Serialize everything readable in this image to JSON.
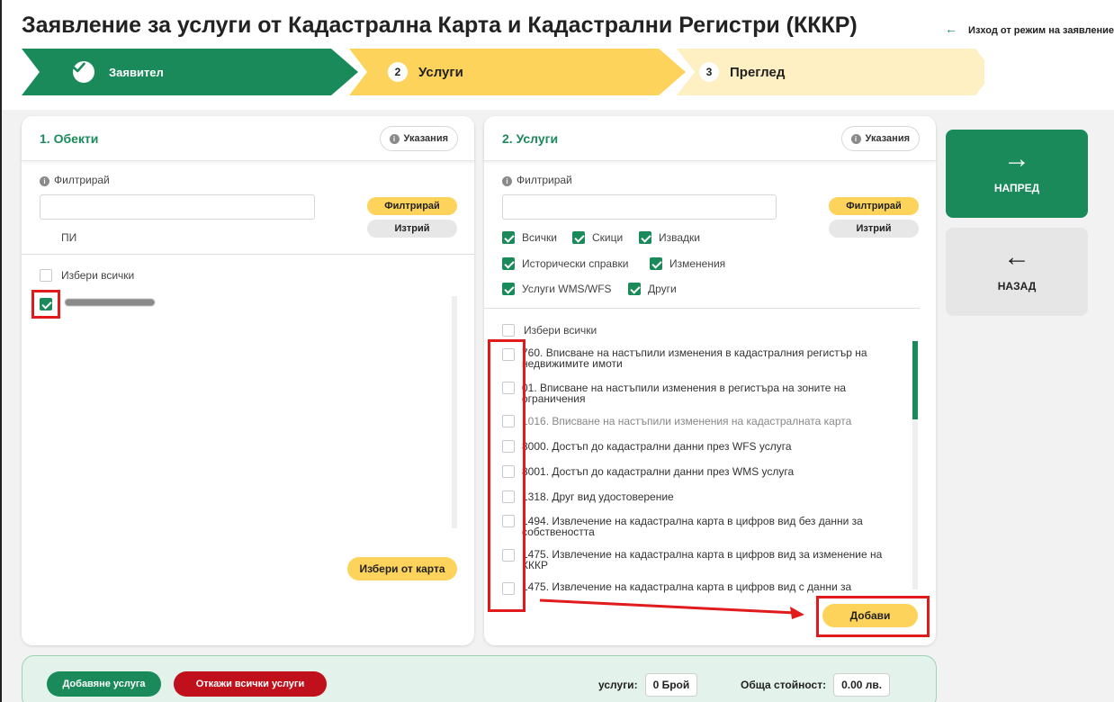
{
  "header": {
    "title": "Заявление за услуги от Кадастрална Карта и Кадастрални Регистри (КККР)",
    "exit_link": "Изход от режим на заявление"
  },
  "steps": [
    {
      "label": "Заявител",
      "state": "done"
    },
    {
      "number": "2",
      "label": "Услуги",
      "state": "active"
    },
    {
      "number": "3",
      "label": "Преглед",
      "state": "pending"
    }
  ],
  "objects_panel": {
    "title": "1. Обекти",
    "hint_button": "Указания",
    "filter_label": "Филтрирай",
    "filter_value": "",
    "filter_button": "Филтрирай",
    "clear_button": "Изтрий",
    "type_label": "ПИ",
    "select_all": "Избери всички",
    "pick_from_map": "Избери от карта"
  },
  "services_panel": {
    "title": "2. Услуги",
    "hint_button": "Указания",
    "filter_label": "Филтрирай",
    "filter_value": "",
    "filter_button": "Филтрирай",
    "clear_button": "Изтрий",
    "categories": [
      "Всички",
      "Скици",
      "Извадки",
      "Исторически справки",
      "Изменения",
      "Услуги WMS/WFS",
      "Други"
    ],
    "select_all": "Избери всички",
    "services": [
      {
        "text": "760. Вписване на настъпили изменения в кадастралния регистър на недвижимите имоти",
        "line2": "недвижимите имоти",
        "line1": "760. Вписване на настъпили изменения в кадастралния регистър на"
      },
      {
        "line1": "01. Вписване на настъпили изменения в регистъра на зоните на",
        "line2": "ограничения"
      },
      {
        "line1": "1016. Вписване на настъпили изменения на кадастралната карта",
        "line2": ""
      },
      {
        "line1": "8000. Достъп до кадастрални данни през WFS услуга",
        "line2": ""
      },
      {
        "line1": "8001. Достъп до кадастрални данни през WMS услуга",
        "line2": ""
      },
      {
        "line1": "1318. Друг вид удостоверение",
        "line2": ""
      },
      {
        "line1": "1494. Извлечение на кадастрална карта в цифров вид без данни за",
        "line2": "собствеността"
      },
      {
        "line1": "1475. Извлечение на кадастрална карта в цифров вид за изменение на",
        "line2": "КККР"
      },
      {
        "line1": "1475. Извлечение на кадастрална карта в цифров вид с данни за",
        "line2": ""
      }
    ],
    "add_button": "Добави"
  },
  "nav": {
    "forward": "НАПРЕД",
    "back": "НАЗАД"
  },
  "footer": {
    "add_service": "Добавяне услуга",
    "cancel_all": "Откажи всички услуги",
    "services_label": "услуги:",
    "services_count": "0 Брой",
    "total_label": "Обща стойност:",
    "total_value": "0.00 лв."
  },
  "colors": {
    "primary": "#1a8a5a",
    "accent": "#fdd35b",
    "danger": "#c0101b",
    "annotation": "#e11b1b"
  }
}
